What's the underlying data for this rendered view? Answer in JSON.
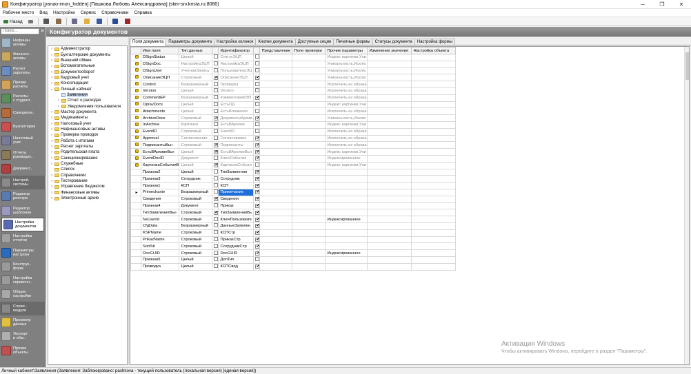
{
  "window": {
    "title": "Конфигуратор [yanao-imon_hidden] [Пашкова Любовь Александровна] (stim-srv.krista.ru:8080)"
  },
  "menu": [
    "Рабочее место",
    "Вид",
    "Настройки",
    "Сервис",
    "Справочники",
    "Справка"
  ],
  "toolbar": {
    "back_label": "Назад"
  },
  "search": {
    "placeholder": "Поиск..."
  },
  "nav": [
    {
      "label": "Нефинан.\nактивы",
      "icon": "box-icon",
      "color": "#9fb7c9"
    },
    {
      "label": "Финансо..\nактивы",
      "icon": "finance-icon",
      "color": "#c9a860"
    },
    {
      "label": "Расчет\nзарплаты",
      "icon": "salary-icon",
      "color": "#6b8ec2"
    },
    {
      "label": "Прочие\nрасчеты",
      "icon": "calc-icon",
      "color": "#d4a35a"
    },
    {
      "label": "Расчеты\nс студент..",
      "icon": "students-icon",
      "color": "#5a8f5a"
    },
    {
      "label": "Санкциони..",
      "icon": "sanction-icon",
      "color": "#b56b3a"
    },
    {
      "label": "Бухгалтерия",
      "icon": "accounting-icon",
      "color": "#c95050"
    },
    {
      "label": "Налоговый\nучет",
      "icon": "tax-icon",
      "color": "#7a7a9a"
    },
    {
      "label": "Отчеты\nруководит..",
      "icon": "reports-icon",
      "color": "#8a7a5a"
    },
    {
      "label": "Документ..",
      "icon": "document-icon",
      "color": "#b04040"
    },
    {
      "label": "Настрой..\nсистемы",
      "icon": "system-settings-icon",
      "color": "#8a8a8a",
      "group": true
    },
    {
      "label": "Редактор\nреестра",
      "icon": "registry-editor-icon",
      "color": "#5a7ab0"
    },
    {
      "label": "Редактор\nшаблонов",
      "icon": "template-editor-icon",
      "color": "#9a9ac0"
    },
    {
      "label": "Настройка\nдокументов",
      "icon": "doc-settings-icon",
      "color": "#5a6ab0",
      "active": true
    },
    {
      "label": "Настройка\nотчетов",
      "icon": "report-settings-icon",
      "color": "#a0a0a0"
    },
    {
      "label": "Параметры\nнастроек",
      "icon": "globe-icon",
      "color": "#2a6ac0"
    },
    {
      "label": "Конструк..\nформ",
      "icon": "form-builder-icon",
      "color": "#9a9a9a"
    },
    {
      "label": "Настройка\nсправочн..",
      "icon": "catalog-settings-icon",
      "color": "#9a9a9a"
    },
    {
      "label": "Общие\nнастройки",
      "icon": "general-settings-icon",
      "color": "#a8a8a8"
    },
    {
      "label": "Служе..\nмодули",
      "icon": "service-modules-icon",
      "color": "#8a8a8a",
      "group": true
    },
    {
      "label": "Просмотр\nданных",
      "icon": "sql-icon",
      "color": "#e0c040"
    },
    {
      "label": "Экспорт\nи обм..",
      "icon": "export-icon",
      "color": "#b0b0b0"
    },
    {
      "label": "Прочие\nобъекты",
      "icon": "other-objects-icon",
      "color": "#c05050"
    }
  ],
  "page_title": "Конфигуратор документов",
  "tree": [
    {
      "label": "Администратор",
      "level": 0,
      "exp": "›"
    },
    {
      "label": "Бухгалтерские документы",
      "level": 0,
      "exp": "›"
    },
    {
      "label": "Внешний обмен",
      "level": 0,
      "exp": "›"
    },
    {
      "label": "Вспомогательные",
      "level": 0,
      "exp": "›"
    },
    {
      "label": "Документооборот",
      "level": 0,
      "exp": "›"
    },
    {
      "label": "Кадровый учет",
      "level": 0,
      "exp": "›"
    },
    {
      "label": "Консолидация",
      "level": 0,
      "exp": "›"
    },
    {
      "label": "Личный кабинет",
      "level": 0,
      "exp": "⌄"
    },
    {
      "label": "Заявления",
      "level": 1,
      "doc": true,
      "selected": true
    },
    {
      "label": "Отчет о расходах",
      "level": 1,
      "exp": "›"
    },
    {
      "label": "Уведомления пользователя",
      "level": 1,
      "exp": "›"
    },
    {
      "label": "Мастер документа",
      "level": 0,
      "exp": "›"
    },
    {
      "label": "Медикаменты",
      "level": 0,
      "exp": "›"
    },
    {
      "label": "Налоговый учет",
      "level": 0,
      "exp": "›"
    },
    {
      "label": "Нефинансовые активы",
      "level": 0,
      "exp": "›"
    },
    {
      "label": "Проверка проводок",
      "level": 0,
      "exp": "›"
    },
    {
      "label": "Работа с итогами",
      "level": 0,
      "exp": "›"
    },
    {
      "label": "Расчет зарплаты",
      "level": 0,
      "exp": "›"
    },
    {
      "label": "Родительская плата",
      "level": 0,
      "exp": "›"
    },
    {
      "label": "Санкционирование",
      "level": 0,
      "exp": "›"
    },
    {
      "label": "Служебные",
      "level": 0,
      "exp": "›"
    },
    {
      "label": "Список",
      "level": 0,
      "exp": ""
    },
    {
      "label": "Справочники",
      "level": 0,
      "exp": "›"
    },
    {
      "label": "Тестирование",
      "level": 0,
      "exp": "›"
    },
    {
      "label": "Управление бюджетом",
      "level": 0,
      "exp": "›"
    },
    {
      "label": "Финансовые активы",
      "level": 0,
      "exp": "›"
    },
    {
      "label": "Электронный архив",
      "level": 0,
      "exp": "›"
    }
  ],
  "tabs": [
    "Поля документа",
    "Параметры документа",
    "Настройка колонок",
    "Кнопки документа",
    "Доступные сеции",
    "Печатные формы",
    "Статусы документа",
    "Настройка формы"
  ],
  "grid": {
    "headers": [
      "Имя поля",
      "Тип данных",
      "Идентификатор",
      "Представление",
      "Поле проверки",
      "Прочие параметры",
      "Изменение значения",
      "Настройка объекта"
    ],
    "rows": [
      {
        "ind": "dot",
        "name": "DSignStatus",
        "type": "Целый",
        "id": "СтатусЭЦП",
        "c1": false,
        "c2": false,
        "other": "Индекс картинки,Уни",
        "gray": true
      },
      {
        "ind": "dot",
        "name": "DSignDoc",
        "type": "НастройкаЭЦП",
        "id": "НастройкаЭЦП",
        "c1": false,
        "c2": false,
        "other": "Уникальность,Исклю",
        "gray": true
      },
      {
        "ind": "dot",
        "name": "DSignUser",
        "type": "УчетнаяЗапись",
        "id": "ПользовательЭЦ",
        "c1": false,
        "c2": false,
        "other": "Уникальность,Исклю",
        "gray": true
      },
      {
        "ind": "dot",
        "name": "ОписаниеЭЦП",
        "type": "Строковый",
        "id": "ОписаниеЭЦП",
        "c1": true,
        "c2": true,
        "other": "Уникальность,Исклю",
        "gray": true
      },
      {
        "ind": "dot",
        "name": "Control",
        "type": "Безразмерный",
        "id": "Проверка",
        "c1": false,
        "c2": false,
        "other": "Исключить из образа",
        "gray": true
      },
      {
        "ind": "dot",
        "name": "Version",
        "type": "Целый",
        "id": "Version",
        "c1": false,
        "c2": false,
        "other": "Исключить из образа",
        "gray": true
      },
      {
        "ind": "dot",
        "name": "CommentEP",
        "type": "Безразмерный",
        "id": "КомментарийЭП",
        "c1": false,
        "c2": true,
        "other": "Исключить из образа",
        "gray": true
      },
      {
        "ind": "dot",
        "name": "OpravDocs",
        "type": "Целый",
        "id": "ЕстьОД",
        "c1": false,
        "c2": false,
        "other": "Индекс картинки,Уни",
        "gray": true
      },
      {
        "ind": "dot",
        "name": "Attachments",
        "type": "Целый",
        "id": "ЕстьВложения",
        "c1": false,
        "c2": false,
        "other": "Исключить из образа",
        "gray": true
      },
      {
        "ind": "dot",
        "name": "ArchiveDocs",
        "type": "Строковый",
        "id": "ДокументыАрхив",
        "c1": true,
        "c2": true,
        "other": "Уникальность,Исклю",
        "gray": true
      },
      {
        "ind": "dot",
        "name": "InArchive",
        "type": "Картинка",
        "id": "ЕстьВАрхиве",
        "c1": false,
        "c2": false,
        "other": "Индекс картинки,Уни",
        "gray": true
      },
      {
        "ind": "dot",
        "name": "EventID",
        "type": "Строковый",
        "id": "EventID",
        "c1": false,
        "c2": false,
        "other": "Исключить из образа",
        "gray": true
      },
      {
        "ind": "dot",
        "name": "Approval",
        "type": "Согласование",
        "id": "Согласование",
        "c1": false,
        "c2": true,
        "other": "Исключить из образа",
        "gray": true
      },
      {
        "ind": "dot",
        "name": "ПодписантыВьн",
        "type": "Строковый",
        "id": "Подписанты",
        "c1": true,
        "c2": true,
        "other": "Исключить из образа",
        "gray": true
      },
      {
        "ind": "dot",
        "name": "ЕстьВАрхивеВьн",
        "type": "Целый",
        "id": "ЕстьВАрхивеВьн",
        "c1": true,
        "c2": true,
        "other": "Индекс картинки,Уни",
        "gray": true
      },
      {
        "ind": "dot",
        "name": "EventDocID",
        "type": "Документ",
        "id": "КлючСобытия",
        "c1": false,
        "c2": true,
        "other": "Индексированное",
        "gray": true
      },
      {
        "ind": "dot",
        "name": "КартинкаСобытияВ",
        "type": "Целый",
        "id": "КартинкаСобыти",
        "c1": true,
        "c2": false,
        "other": "Индекс картинки,Уни",
        "gray": true
      },
      {
        "ind": "",
        "name": "Признак2",
        "type": "Целый",
        "id": "ТипЗаявления",
        "c1": false,
        "c2": true,
        "other": ""
      },
      {
        "ind": "",
        "name": "Признак3",
        "type": "Сотрудник",
        "id": "Сотрудник",
        "c1": false,
        "c2": true,
        "other": ""
      },
      {
        "ind": "",
        "name": "Признак1",
        "type": "КСП",
        "id": "КСП",
        "c1": false,
        "c2": true,
        "other": ""
      },
      {
        "ind": "arrow",
        "name": "Primechanie",
        "type": "Безразмерный",
        "id": "Примечание",
        "c1": false,
        "c2": true,
        "other": "",
        "editing": true
      },
      {
        "ind": "",
        "name": "Сведения",
        "type": "Строковый",
        "id": "Сведения",
        "c1": true,
        "c2": true,
        "other": ""
      },
      {
        "ind": "",
        "name": "Признак4",
        "type": "Документ",
        "id": "Приказ",
        "c1": false,
        "c2": true,
        "other": ""
      },
      {
        "ind": "",
        "name": "ТипЗаявленияВьн",
        "type": "Строковый",
        "id": "ТипЗаявленияВь",
        "c1": true,
        "c2": true,
        "other": ""
      },
      {
        "ind": "",
        "name": "NsUserId",
        "type": "Строковый",
        "id": "КлючПользовате",
        "c1": false,
        "c2": true,
        "other": "Индексированное"
      },
      {
        "ind": "",
        "name": "CfgData",
        "type": "Безразмерный",
        "id": "ДанныеЗаявлен",
        "c1": false,
        "c2": true,
        "other": ""
      },
      {
        "ind": "",
        "name": "KSPName",
        "type": "Строковый",
        "id": "КСПСтр",
        "c1": false,
        "c2": true,
        "other": ""
      },
      {
        "ind": "",
        "name": "PrikazName",
        "type": "Строковый",
        "id": "ПриказСтр",
        "c1": false,
        "c2": true,
        "other": ""
      },
      {
        "ind": "",
        "name": "SotrStr",
        "type": "Строковый",
        "id": "СотрудникСтр",
        "c1": false,
        "c2": true,
        "other": ""
      },
      {
        "ind": "",
        "name": "DocGUID",
        "type": "Строковый",
        "id": "DocGUID",
        "c1": false,
        "c2": true,
        "other": "Индексированное"
      },
      {
        "ind": "",
        "name": "Признак5",
        "type": "Целый",
        "id": "ДопТип",
        "c1": false,
        "c2": false,
        "other": ""
      },
      {
        "ind": "",
        "name": "Проводка",
        "type": "Целый",
        "id": "КСПСвод",
        "c1": false,
        "c2": true,
        "other": ""
      }
    ]
  },
  "watermark": {
    "line1": "Активация Windows",
    "line2": "Чтобы активировать Windows, перейдите в раздел \"Параметры\"."
  },
  "status": "Личный кабинет\\Заявления (Заявления: Заблокировано: pashkova - текущий пользователь (локальная версия) [единая версия])"
}
